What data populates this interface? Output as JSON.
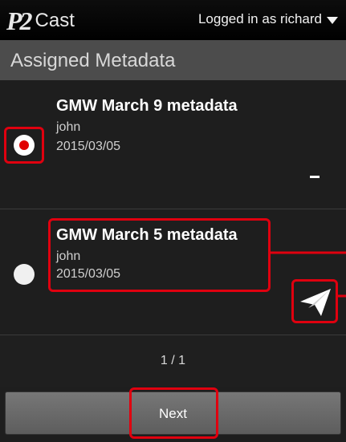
{
  "header": {
    "logo_mark": "P2",
    "logo_text": "Cast",
    "user_label": "Logged in as richard"
  },
  "section": {
    "title": "Assigned Metadata"
  },
  "items": [
    {
      "title": "GMW March 9 metadata",
      "user": "john",
      "date": "2015/03/05",
      "selected": true
    },
    {
      "title": "GMW March 5 metadata",
      "user": "john",
      "date": "2015/03/05",
      "selected": false
    }
  ],
  "pager": {
    "label": "1 / 1"
  },
  "footer": {
    "next_label": "Next"
  },
  "icons": {
    "send": "paper-plane-icon",
    "dropdown": "caret-down-icon"
  },
  "colors": {
    "highlight": "#e0000f",
    "radio_selected": "#e00000"
  }
}
